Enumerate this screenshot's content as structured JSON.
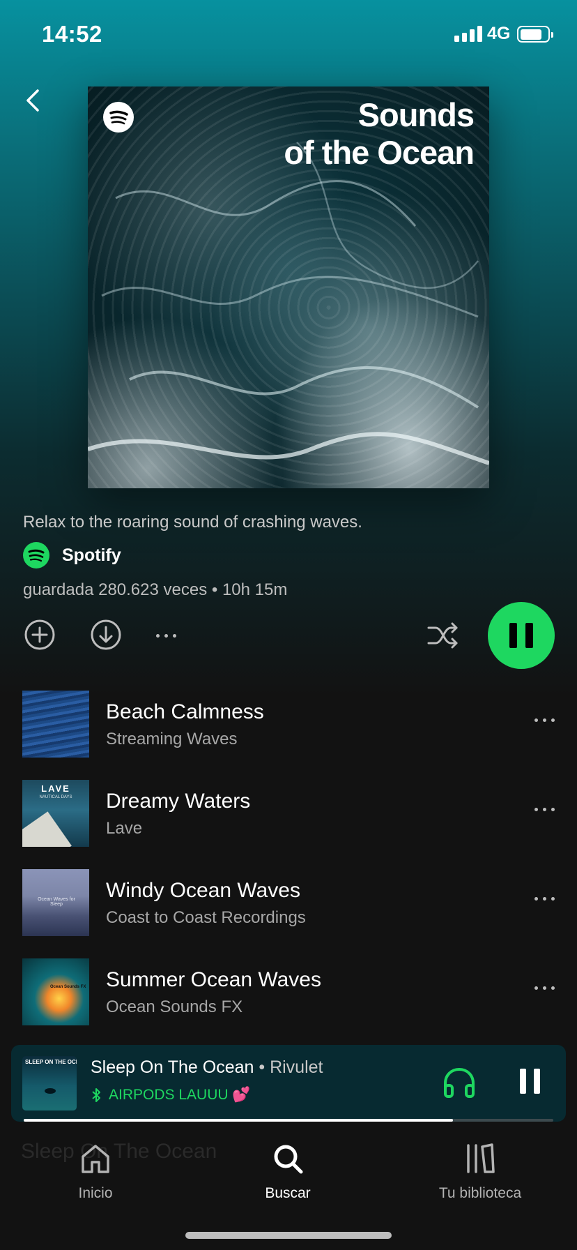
{
  "status_bar": {
    "time": "14:52",
    "network": "4G"
  },
  "playlist": {
    "cover_title": "Sounds\nof the Ocean",
    "description": "Relax to the roaring sound of crashing waves.",
    "owner": "Spotify",
    "meta": "guardada 280.623 veces • 10h 15m"
  },
  "tracks": [
    {
      "title": "Beach Calmness",
      "artist": "Streaming Waves"
    },
    {
      "title": "Dreamy Waters",
      "artist": "Lave"
    },
    {
      "title": "Windy Ocean Waves",
      "artist": "Coast to Coast Recordings"
    },
    {
      "title": "Summer Ocean Waves",
      "artist": "Ocean Sounds FX"
    }
  ],
  "thumb_text": {
    "lave_title": "LAVE",
    "lave_sub": "NAUTICAL DAYS",
    "ocean_waves": "Ocean Waves for Sleep",
    "summer": "Ocean Sounds FX"
  },
  "now_playing": {
    "art_label": "SLEEP ON THE OCEAN",
    "title": "Sleep On The Ocean",
    "separator": " • ",
    "artist": "Rivulet",
    "device": "AIRPODS LAUUU 💕",
    "progress": 0.81
  },
  "ghost_text": "Sleep On The Ocean",
  "nav": {
    "home": "Inicio",
    "search": "Buscar",
    "library": "Tu biblioteca"
  },
  "colors": {
    "accent": "#1ed760",
    "background": "#121212",
    "header_gradient_top": "#07919f"
  }
}
